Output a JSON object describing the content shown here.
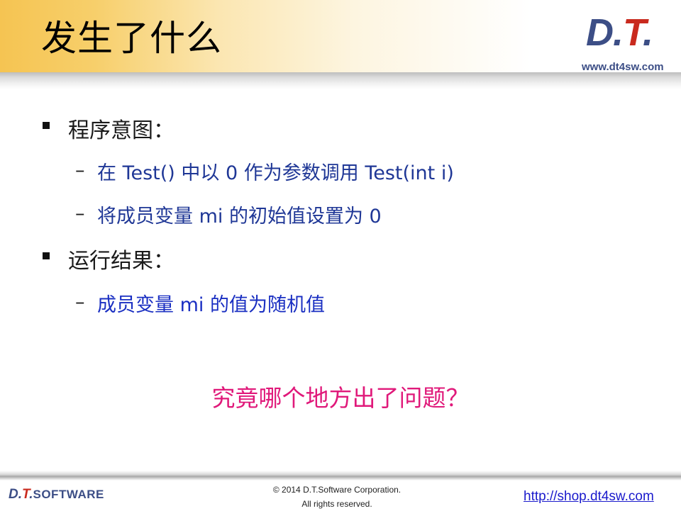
{
  "slide": {
    "title": "发生了什么"
  },
  "logo": {
    "d": "D",
    "dot1": ".",
    "t": "T",
    "dot2": ".",
    "site": "www.dt4sw.com"
  },
  "content": {
    "bullet1": "程序意图：",
    "bullet1_subs": [
      "在 Test() 中以 0 作为参数调用 Test(int i)",
      "将成员变量 mi 的初始值设置为 0"
    ],
    "bullet2": "运行结果：",
    "bullet2_subs": [
      "成员变量 mi 的值为随机值"
    ],
    "dash": "–",
    "question": "究竟哪个地方出了问题？"
  },
  "footer": {
    "logo_d": "D",
    "logo_dot1": ".",
    "logo_t": "T",
    "logo_dot2": ".",
    "logo_software": "SOFTWARE",
    "copyright_line1": "© 2014 D.T.Software Corporation.",
    "copyright_line2": "All rights reserved.",
    "shop_link": "http://shop.dt4sw.com"
  },
  "colors": {
    "accent_gold": "#f5c452",
    "sub_text_blue": "#1f3796",
    "question_magenta": "#e0197a",
    "logo_navy": "#3c4e86",
    "logo_red": "#c92a1e",
    "link_blue": "#1a1acc"
  }
}
